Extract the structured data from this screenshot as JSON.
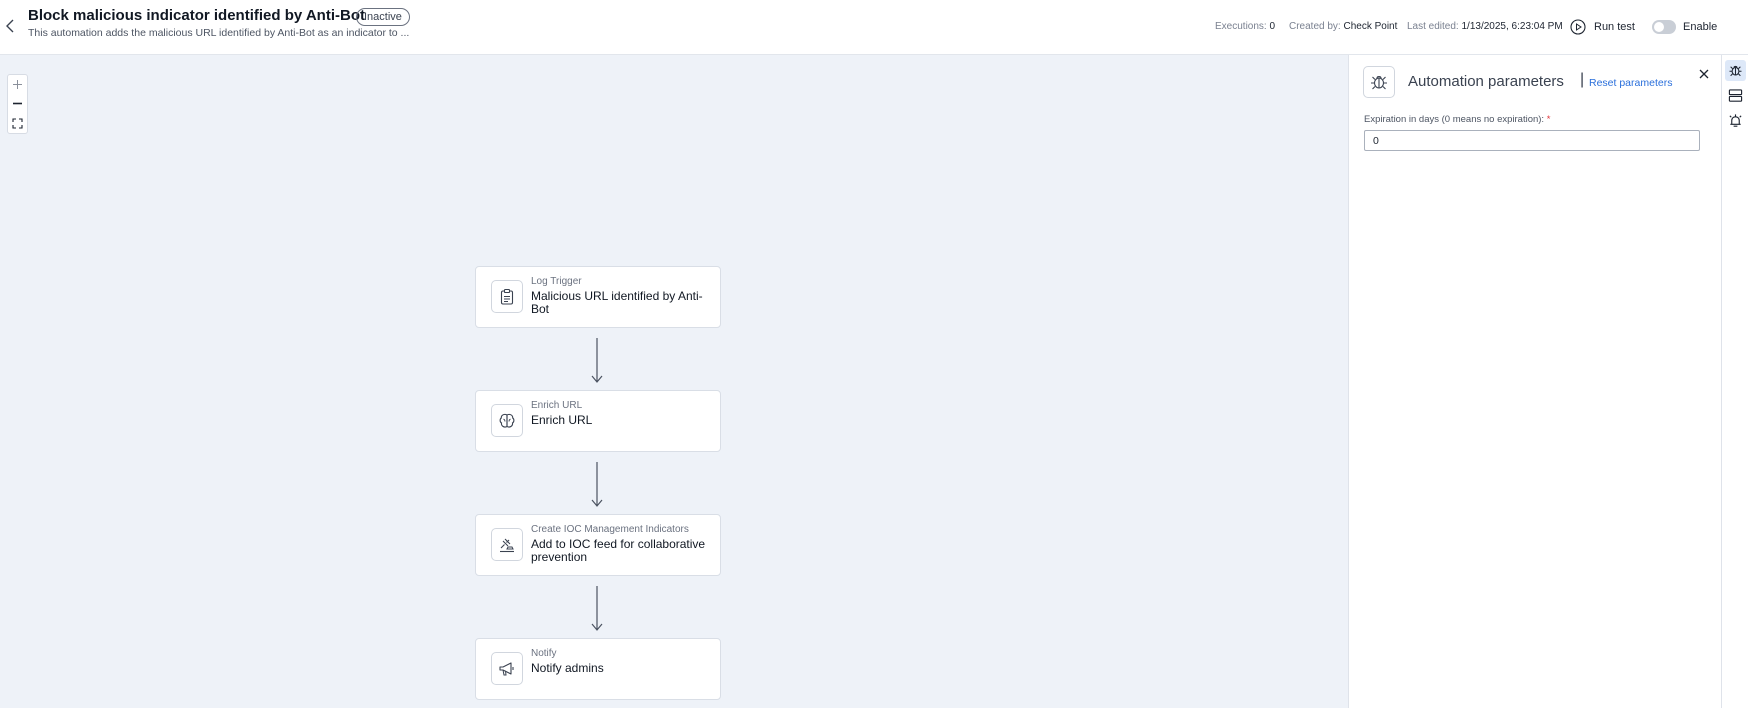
{
  "header": {
    "title": "Block malicious indicator identified by Anti-Bot",
    "status": "Inactive",
    "subtitle": "This automation adds the malicious URL identified by Anti-Bot as an indicator to ...",
    "executions_label": "Executions:",
    "executions_value": "0",
    "created_label": "Created by:",
    "created_value": "Check Point",
    "edited_label": "Last edited:",
    "edited_value": "1/13/2025, 6:23:04 PM",
    "run_test_label": "Run test",
    "enable_label": "Enable"
  },
  "canvas": {
    "zoom_in": "+",
    "zoom_out": "–",
    "nodes": [
      {
        "type": "Log Trigger",
        "label": "Malicious URL identified by Anti-Bot",
        "icon": "clipboard-icon"
      },
      {
        "type": "Enrich URL",
        "label": "Enrich URL",
        "icon": "brain-icon"
      },
      {
        "type": "Create IOC Management Indicators",
        "label": "Add to IOC feed for collaborative prevention",
        "icon": "gavel-icon"
      },
      {
        "type": "Notify",
        "label": "Notify admins",
        "icon": "megaphone-icon"
      }
    ]
  },
  "panel": {
    "title": "Automation parameters",
    "separator": "|",
    "reset_label": "Reset parameters",
    "field_label": "Expiration in days (0 means no expiration):",
    "required_mark": "*",
    "field_value": "0"
  },
  "colors": {
    "accent": "#2a6fdb",
    "canvas_bg": "#eef2f8",
    "required": "#e0343a"
  }
}
